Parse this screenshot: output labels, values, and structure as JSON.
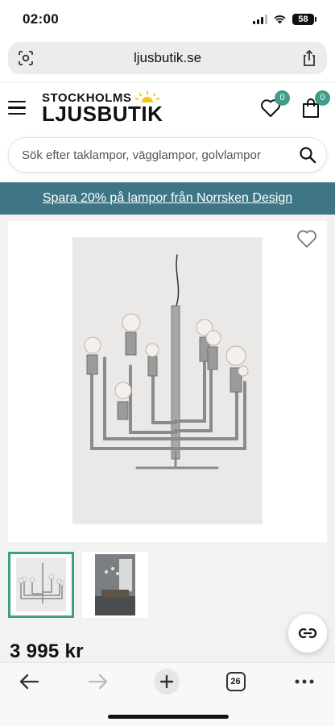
{
  "status_bar": {
    "time": "02:00",
    "battery": "58"
  },
  "browser": {
    "url": "ljusbutik.se",
    "tab_count": "26"
  },
  "site": {
    "logo_line1": "STOCKHOLMS",
    "logo_line2": "LJUSBUTIK",
    "wishlist_count": "0",
    "cart_count": "0"
  },
  "search": {
    "placeholder": "Sök efter taklampor, vägglampor, golvlampor"
  },
  "promo": {
    "text": "Spara 20% på lampor från Norrsken Design"
  },
  "product": {
    "price": "3 995 kr"
  },
  "colors": {
    "accent": "#3e9e8a",
    "promo_bg": "#3f7686",
    "logo_sun": "#f5c518"
  },
  "icons": [
    "camera-lens-icon",
    "share-icon",
    "menu-icon",
    "heart-icon",
    "bag-icon",
    "search-icon",
    "compare-icon",
    "back-icon",
    "forward-icon",
    "plus-icon",
    "more-icon"
  ]
}
